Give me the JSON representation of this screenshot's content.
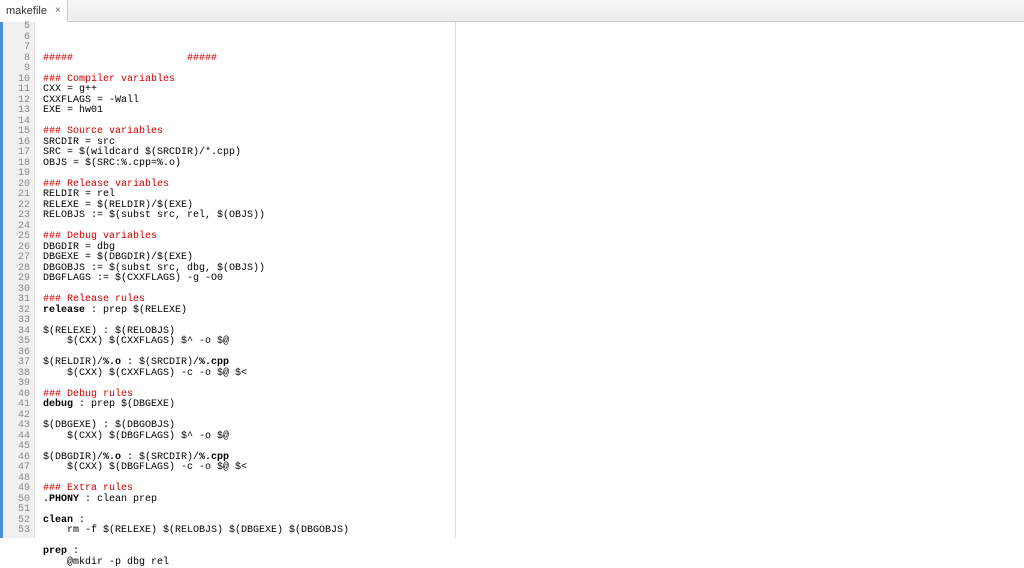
{
  "tab": {
    "label": "makefile",
    "close": "×"
  },
  "lineStart": 5,
  "lineEnd": 53,
  "code": [
    {
      "tokens": [
        {
          "t": "#####",
          "c": "red"
        },
        {
          "t": "                   "
        },
        {
          "t": "#####",
          "c": "red"
        }
      ]
    },
    {
      "tokens": []
    },
    {
      "tokens": [
        {
          "t": "### Compiler variables",
          "c": "red"
        }
      ]
    },
    {
      "tokens": [
        {
          "t": "CXX = g++"
        }
      ]
    },
    {
      "tokens": [
        {
          "t": "CXXFLAGS = -Wall"
        }
      ]
    },
    {
      "tokens": [
        {
          "t": "EXE = hw01"
        }
      ]
    },
    {
      "tokens": []
    },
    {
      "tokens": [
        {
          "t": "### Source variables",
          "c": "red"
        }
      ]
    },
    {
      "tokens": [
        {
          "t": "SRCDIR = src"
        }
      ]
    },
    {
      "tokens": [
        {
          "t": "SRC = $(wildcard $(SRCDIR)/*.cpp)"
        }
      ]
    },
    {
      "tokens": [
        {
          "t": "OBJS = $(SRC:%.cpp=%.o)"
        }
      ]
    },
    {
      "tokens": []
    },
    {
      "tokens": [
        {
          "t": "### Release variables",
          "c": "red"
        }
      ]
    },
    {
      "tokens": [
        {
          "t": "RELDIR = rel"
        }
      ]
    },
    {
      "tokens": [
        {
          "t": "RELEXE = $(RELDIR)/$(EXE)"
        }
      ]
    },
    {
      "tokens": [
        {
          "t": "RELOBJS := $(subst src, rel, $(OBJS))"
        }
      ]
    },
    {
      "tokens": []
    },
    {
      "tokens": [
        {
          "t": "### Debug variables",
          "c": "red"
        }
      ]
    },
    {
      "tokens": [
        {
          "t": "DBGDIR = dbg"
        }
      ]
    },
    {
      "tokens": [
        {
          "t": "DBGEXE = $(DBGDIR)/$(EXE)"
        }
      ]
    },
    {
      "tokens": [
        {
          "t": "DBGOBJS := $(subst src, dbg, $(OBJS))"
        }
      ]
    },
    {
      "tokens": [
        {
          "t": "DBGFLAGS := $(CXXFLAGS) -g -O0"
        }
      ]
    },
    {
      "tokens": []
    },
    {
      "tokens": [
        {
          "t": "### Release rules",
          "c": "red"
        }
      ]
    },
    {
      "tokens": [
        {
          "t": "release",
          "c": "bold"
        },
        {
          "t": " : prep $(RELEXE)"
        }
      ]
    },
    {
      "tokens": []
    },
    {
      "tokens": [
        {
          "t": "$(RELEXE) : $(RELOBJS)"
        }
      ]
    },
    {
      "tokens": [
        {
          "t": "    $(CXX) $(CXXFLAGS) $^ -o $@"
        }
      ]
    },
    {
      "tokens": []
    },
    {
      "tokens": [
        {
          "t": "$(RELDIR)/"
        },
        {
          "t": "%.o",
          "c": "bold"
        },
        {
          "t": " : $(SRCDIR)/"
        },
        {
          "t": "%.cpp",
          "c": "bold"
        }
      ]
    },
    {
      "tokens": [
        {
          "t": "    $(CXX) $(CXXFLAGS) -c -o $@ $<"
        }
      ]
    },
    {
      "tokens": []
    },
    {
      "tokens": [
        {
          "t": "### Debug rules",
          "c": "red"
        }
      ]
    },
    {
      "tokens": [
        {
          "t": "debug",
          "c": "bold"
        },
        {
          "t": " : prep $(DBGEXE)"
        }
      ]
    },
    {
      "tokens": []
    },
    {
      "tokens": [
        {
          "t": "$(DBGEXE) : $(DBGOBJS)"
        }
      ]
    },
    {
      "tokens": [
        {
          "t": "    $(CXX) $(DBGFLAGS) $^ -o $@"
        }
      ]
    },
    {
      "tokens": []
    },
    {
      "tokens": [
        {
          "t": "$(DBGDIR)/"
        },
        {
          "t": "%.o",
          "c": "bold"
        },
        {
          "t": " : $(SRCDIR)/"
        },
        {
          "t": "%.cpp",
          "c": "bold"
        }
      ]
    },
    {
      "tokens": [
        {
          "t": "    $(CXX) $(DBGFLAGS) -c -o $@ $<"
        }
      ]
    },
    {
      "tokens": []
    },
    {
      "tokens": [
        {
          "t": "### Extra rules",
          "c": "red"
        }
      ]
    },
    {
      "tokens": [
        {
          "t": ".PHONY",
          "c": "bold"
        },
        {
          "t": " : clean prep"
        }
      ]
    },
    {
      "tokens": []
    },
    {
      "tokens": [
        {
          "t": "clean",
          "c": "bold"
        },
        {
          "t": " :"
        }
      ]
    },
    {
      "tokens": [
        {
          "t": "    rm -f $(RELEXE) $(RELOBJS) $(DBGEXE) $(DBGOBJS)"
        }
      ]
    },
    {
      "tokens": []
    },
    {
      "tokens": [
        {
          "t": "prep",
          "c": "bold"
        },
        {
          "t": " :"
        }
      ]
    },
    {
      "tokens": [
        {
          "t": "    @mkdir -p dbg rel"
        }
      ]
    }
  ]
}
